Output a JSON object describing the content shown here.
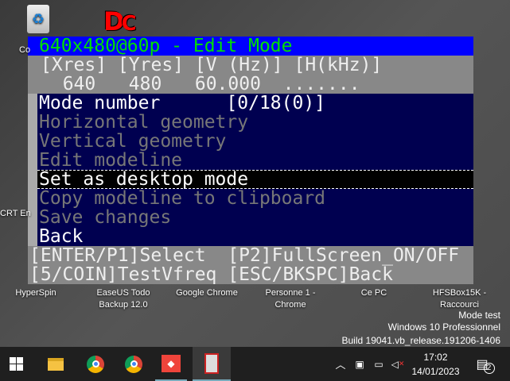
{
  "desktop": {
    "icons": [
      {
        "label": "Co"
      },
      {
        "label": "CRT En"
      },
      {
        "label": "HyperSpin"
      },
      {
        "label": "EaseUS Todo Backup 12.0"
      },
      {
        "label": "Google Chrome"
      },
      {
        "label": "Personne 1 - Chrome"
      },
      {
        "label": "Ce PC"
      },
      {
        "label": "HFSBox15K - Raccourci"
      }
    ],
    "dc_logo": "DC",
    "watermark": [
      "Mode test",
      "Windows 10 Professionnel",
      "Build 19041.vb_release.191206-1406"
    ]
  },
  "panel": {
    "title": "640x480@60p - Edit Mode",
    "info_header": "[Xres] [Yres] [V (Hz)] [H(kHz)]",
    "info_values": "  640   480   60.000  .......",
    "menu": [
      {
        "label": "Mode number      [0/18(0)]",
        "state": "enabled"
      },
      {
        "label": "Horizontal geometry",
        "state": "disabled"
      },
      {
        "label": "Vertical geometry",
        "state": "disabled"
      },
      {
        "label": "Edit modeline",
        "state": "disabled"
      },
      {
        "label": "Set as desktop mode",
        "state": "selected"
      },
      {
        "label": "Copy modeline to clipboard",
        "state": "disabled"
      },
      {
        "label": "Save changes",
        "state": "disabled"
      },
      {
        "label": "Back",
        "state": "enabled"
      }
    ],
    "footer": [
      "[ENTER/P1]Select  [P2]FullScreen_ON/OFF",
      "[5/COIN]TestVfreq [ESC/BKSPC]Back"
    ]
  },
  "taskbar": {
    "time": "17:02",
    "date": "14/01/2023",
    "notifications": "2"
  },
  "colors": {
    "title_bg": "#0000ff",
    "title_fg": "#00e000",
    "menu_bg": "#000050",
    "info_bg": "#888888"
  }
}
